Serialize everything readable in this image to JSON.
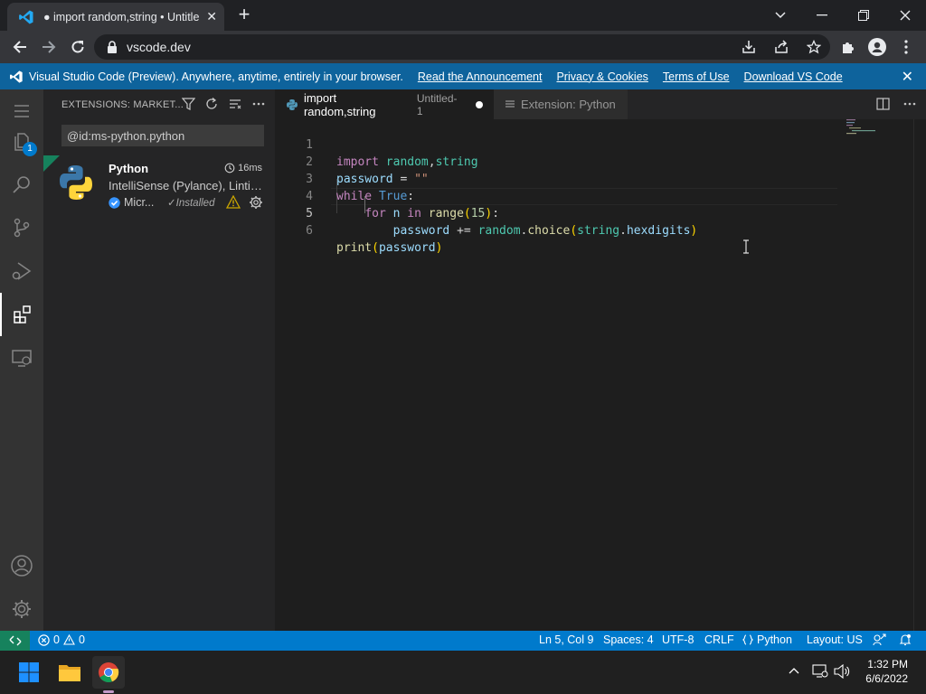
{
  "browser": {
    "tab_title": "● import random,string • Untitled",
    "url": "vscode.dev"
  },
  "banner": {
    "text": "Visual Studio Code (Preview). Anywhere, anytime, entirely in your browser.",
    "links": [
      "Read the Announcement",
      "Privacy & Cookies",
      "Terms of Use",
      "Download VS Code"
    ]
  },
  "activity": {
    "explorer_badge": "1"
  },
  "sidebar": {
    "title": "EXTENSIONS: MARKET...",
    "search_value": "@id:ms-python.python",
    "extension": {
      "name": "Python",
      "time": "16ms",
      "description": "IntelliSense (Pylance), Linting, Debugging",
      "publisher": "Micr...",
      "status": "✓Installed"
    }
  },
  "editor": {
    "tabs": [
      {
        "label": "import random,string",
        "sub": "Untitled-1"
      },
      {
        "label": "Extension: Python"
      }
    ],
    "line_numbers": [
      "1",
      "2",
      "3",
      "4",
      "5",
      "6"
    ]
  },
  "statusbar": {
    "errors": "0",
    "warnings": "0",
    "position": "Ln 5, Col 9",
    "spaces": "Spaces: 4",
    "encoding": "UTF-8",
    "eol": "CRLF",
    "language": "Python",
    "layout": "Layout: US"
  },
  "taskbar": {
    "time": "1:32 PM",
    "date": "6/6/2022"
  },
  "colors": {
    "statusbar": "#007acc",
    "banner": "#0e639c",
    "remote": "#16825d",
    "activity_bar": "#333333",
    "sidebar": "#252526",
    "editor": "#1e1e1e"
  }
}
